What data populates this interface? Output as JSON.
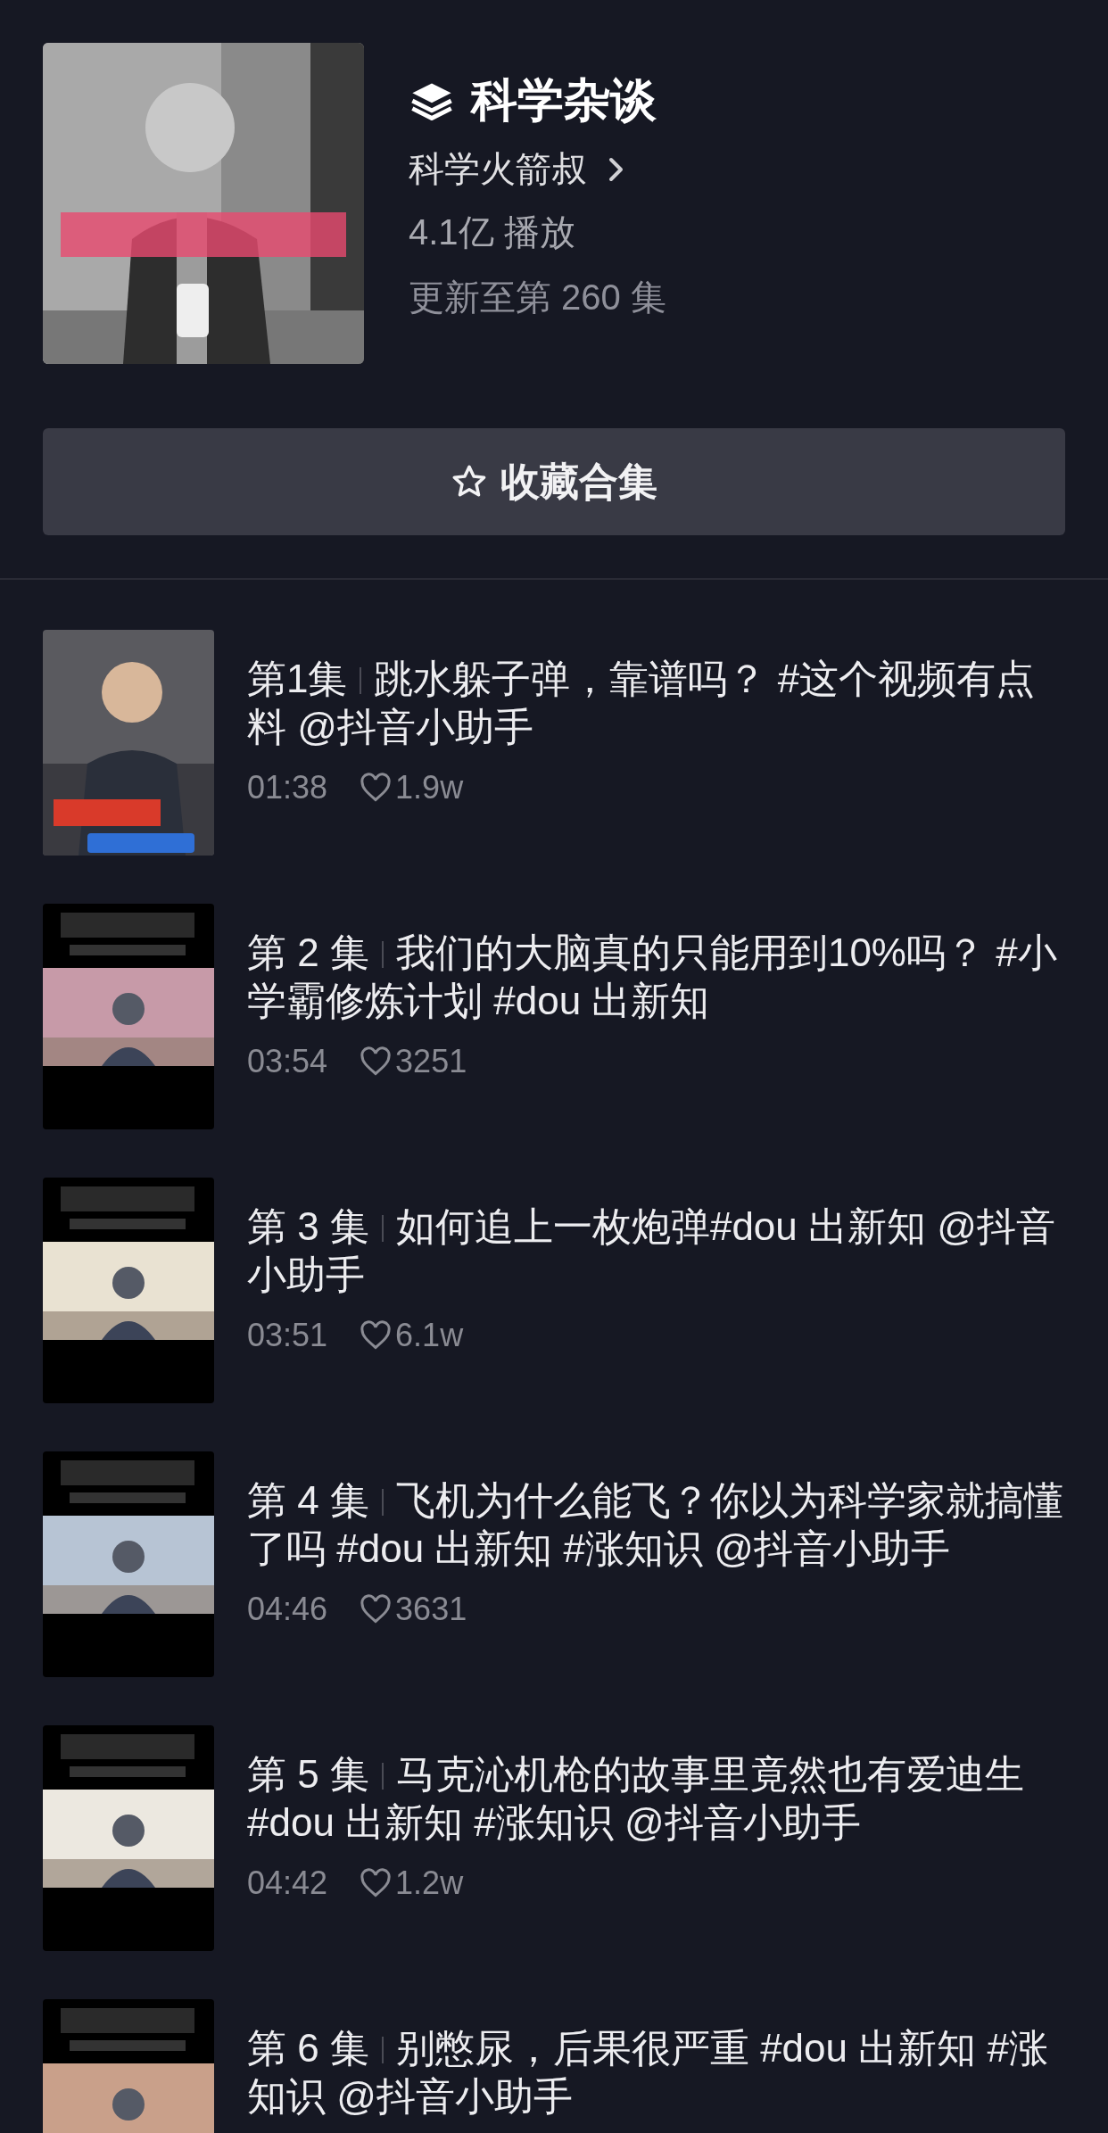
{
  "collection": {
    "title": "科学杂谈",
    "creator": "科学火箭叔",
    "plays": "4.1亿 播放",
    "update_status": "更新至第 260 集"
  },
  "favorite_button": {
    "label": "收藏合集"
  },
  "episodes": [
    {
      "episode": "第1集",
      "title": "跳水躲子弹，靠谱吗？ #这个视频有点料  @抖音小助手",
      "duration": "01:38",
      "likes": "1.9w"
    },
    {
      "episode": "第 2 集",
      "title": "我们的大脑真的只能用到10%吗？ #小学霸修炼计划  #dou 出新知",
      "duration": "03:54",
      "likes": "3251"
    },
    {
      "episode": "第 3 集",
      "title": "如何追上一枚炮弹#dou 出新知 @抖音小助手",
      "duration": "03:51",
      "likes": "6.1w"
    },
    {
      "episode": "第 4 集",
      "title": "飞机为什么能飞？你以为科学家就搞懂了吗 #dou 出新知 #涨知识 @抖音小助手",
      "duration": "04:46",
      "likes": "3631"
    },
    {
      "episode": "第 5 集",
      "title": "马克沁机枪的故事里竟然也有爱迪生 #dou 出新知  #涨知识  @抖音小助手",
      "duration": "04:42",
      "likes": "1.2w"
    },
    {
      "episode": "第 6 集",
      "title": "别憋尿，后果很严重 #dou 出新知  #涨知识  @抖音小助手"
    }
  ]
}
